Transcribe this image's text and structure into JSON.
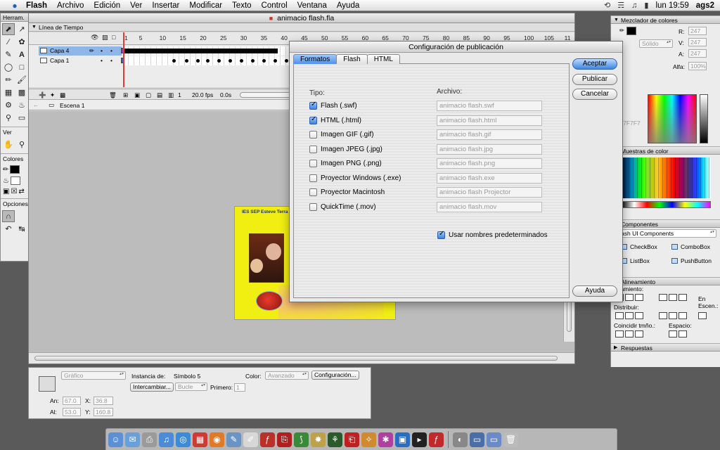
{
  "menubar": {
    "apple_glyph": "",
    "items": [
      "Flash",
      "Archivo",
      "Edición",
      "Ver",
      "Insertar",
      "Modificar",
      "Texto",
      "Control",
      "Ventana",
      "Ayuda"
    ],
    "clock": "lun 19:59",
    "user": "ags2"
  },
  "tools": {
    "title": "Herram.",
    "view_label": "Ver",
    "colors_label": "Colores",
    "options_label": "Opciones"
  },
  "document": {
    "title": "animacio flash.fla",
    "timeline_title": "Línea de Tiempo",
    "ruler_numbers": [
      "1",
      "5",
      "10",
      "15",
      "20",
      "25",
      "30",
      "35",
      "40",
      "45",
      "50",
      "55",
      "60",
      "65",
      "70",
      "75",
      "80",
      "85",
      "90",
      "95",
      "100",
      "105",
      "11"
    ],
    "layers": [
      {
        "name": "Capa 4",
        "color": "#9b34c9",
        "selected": true
      },
      {
        "name": "Capa 1",
        "color": "#3a5fd6",
        "selected": false
      }
    ],
    "footer": {
      "frame": "1",
      "fps": "20.0 fps",
      "time": "0.0s"
    },
    "scene": "Escena 1",
    "stage_header": "IES SEP Esteve Terra"
  },
  "properties": {
    "type_popup": "Gráfico",
    "instance_label": "Instancia de:",
    "instance_value": "Símbolo 5",
    "color_label": "Color:",
    "color_popup": "Avanzado",
    "config_button": "Configuración...",
    "swap_button": "Intercambiar...",
    "loop_popup": "Bucle",
    "first_label": "Primero:",
    "first_value": "1",
    "width_label": "An:",
    "width_value": "67.0",
    "x_label": "X:",
    "x_value": "36.8",
    "height_label": "Al:",
    "height_value": "53.0",
    "y_label": "Y:",
    "y_value": "160.8"
  },
  "right_panels": {
    "mixer_title": "Mezclador de colores",
    "r_label": "R:",
    "r_value": "247",
    "v_label": "V:",
    "v_value": "247",
    "a_label": "A:",
    "a_value": "247",
    "alpha_label": "Alfa:",
    "alpha_value": "100%",
    "fill_popup": "Sólido",
    "hex_value": "F7F7F7",
    "swatches_title": "Muestras de color",
    "components_title": "Componentes",
    "components_set": "ash UI Components",
    "components": [
      "CheckBox",
      "ComboBox",
      "ListBox",
      "PushButton"
    ],
    "align_title": "Alineamiento",
    "align_label": "neamiento:",
    "distribute_label": "Distribuir:",
    "match_label": "Coincidir tmño.:",
    "space_label": "Espacio:",
    "in_label": "En",
    "scene_label": "Escen.:",
    "answers_title": "Respuestas"
  },
  "dialog": {
    "title": "Configuración de publicación",
    "tabs": [
      "Formatos",
      "Flash",
      "HTML"
    ],
    "type_header": "Tipo:",
    "file_header": "Archivo:",
    "formats": [
      {
        "label": "Flash  (.swf)",
        "checked": true,
        "file": "animacio flash.swf"
      },
      {
        "label": "HTML  (.html)",
        "checked": true,
        "file": "animacio flash.html"
      },
      {
        "label": "Imagen GIF  (.gif)",
        "checked": false,
        "file": "animacio flash.gif"
      },
      {
        "label": "Imagen JPEG  (.jpg)",
        "checked": false,
        "file": "animacio flash.jpg"
      },
      {
        "label": "Imagen PNG  (.png)",
        "checked": false,
        "file": "animacio flash.png"
      },
      {
        "label": "Proyector Windows  (.exe)",
        "checked": false,
        "file": "animacio flash.exe"
      },
      {
        "label": "Proyector Macintosh",
        "checked": false,
        "file": "animacio flash Projector"
      },
      {
        "label": "QuickTime  (.mov)",
        "checked": false,
        "file": "animacio flash.mov"
      }
    ],
    "default_names_label": "Usar nombres predeterminados",
    "default_names_checked": true,
    "buttons": {
      "accept": "Aceptar",
      "publish": "Publicar",
      "cancel": "Cancelar",
      "help": "Ayuda"
    }
  },
  "dock": {
    "icons": [
      "finder-icon",
      "mail-icon",
      "printer-icon",
      "itunes-icon",
      "safari-icon",
      "ical-icon",
      "firefox-icon",
      "preview-icon",
      "pages-icon",
      "flash-icon",
      "acrobat-icon",
      "dreamweaver-icon",
      "sharpen-icon",
      "director-icon",
      "acrobat-reader-icon",
      "fireworks-icon",
      "palette-icon",
      "photoshop-icon",
      "terminal-icon",
      "flash-player-icon",
      "cd-icon",
      "window-icon",
      "window2-icon",
      "trash-icon"
    ]
  }
}
